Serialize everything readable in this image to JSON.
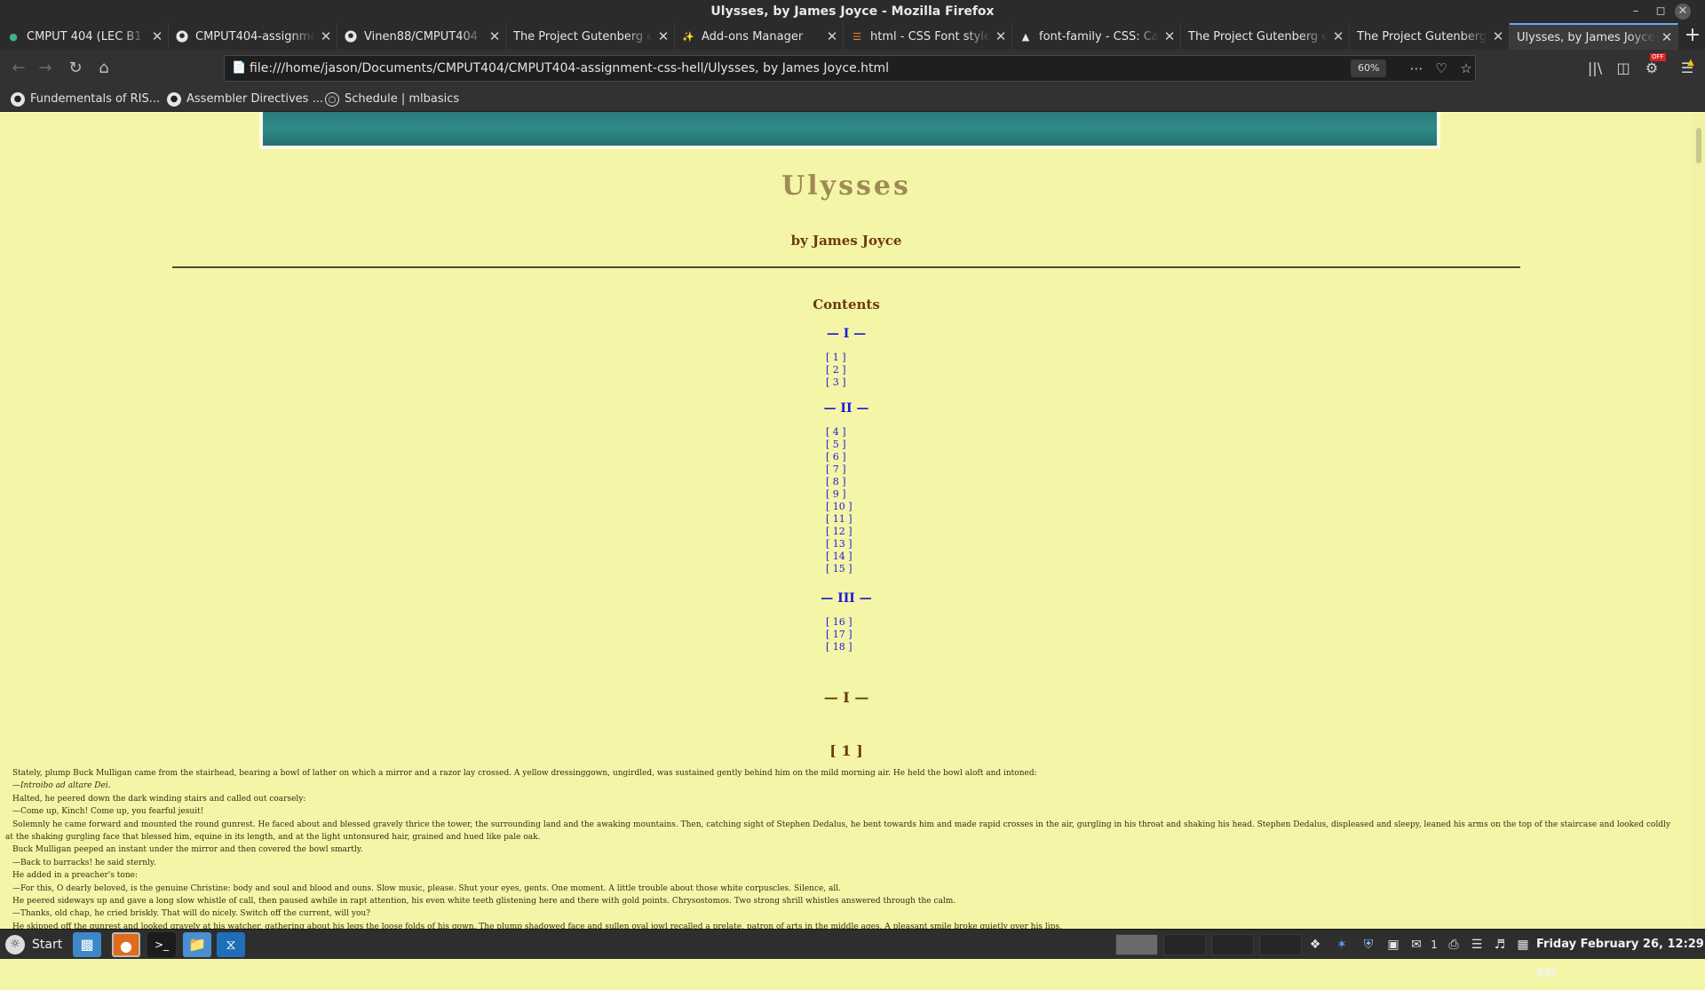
{
  "window": {
    "title": "Ulysses, by James Joyce - Mozilla Firefox"
  },
  "tabs": [
    {
      "label": "CMPUT 404 (LEC B1 W",
      "icon": "eclass-icon"
    },
    {
      "label": "CMPUT404-assignme",
      "icon": "github-icon"
    },
    {
      "label": "Vinen88/CMPUT404",
      "icon": "github-icon"
    },
    {
      "label": "The Project Gutenberg e",
      "icon": "none"
    },
    {
      "label": "Add-ons Manager",
      "icon": "puzzle-icon"
    },
    {
      "label": "html - CSS Font style",
      "icon": "stackoverflow-icon"
    },
    {
      "label": "font-family - CSS: Cas",
      "icon": "mdn-icon"
    },
    {
      "label": "The Project Gutenberg e",
      "icon": "none"
    },
    {
      "label": "The Project Gutenberg e",
      "icon": "none"
    },
    {
      "label": "Ulysses, by James Joyce",
      "icon": "none",
      "active": true
    }
  ],
  "nav": {
    "url": "file:///home/jason/Documents/CMPUT404/CMPUT404-assignment-css-hell/Ulysses, by James Joyce.html",
    "zoom": "60%",
    "badge_off": "OFF"
  },
  "bookmarks": [
    {
      "label": "Fundementals of RIS...",
      "icon": "github-icon"
    },
    {
      "label": "Assembler Directives ...",
      "icon": "github-icon"
    },
    {
      "label": "Schedule | mlbasics",
      "icon": "globe-icon"
    }
  ],
  "page": {
    "title": "Ulysses",
    "author": "by James Joyce",
    "contents_heading": "Contents",
    "toc": [
      {
        "part": "— I —",
        "chapters": [
          "[ 1 ]",
          "[ 2 ]",
          "[ 3 ]"
        ]
      },
      {
        "part": "— II —",
        "chapters": [
          "[ 4 ]",
          "[ 5 ]",
          "[ 6 ]",
          "[ 7 ]",
          "[ 8 ]",
          "[ 9 ]",
          "[ 10 ]",
          "[ 11 ]",
          "[ 12 ]",
          "[ 13 ]",
          "[ 14 ]",
          "[ 15 ]"
        ]
      },
      {
        "part": "— III —",
        "chapters": [
          "[ 16 ]",
          "[ 17 ]",
          "[ 18 ]"
        ]
      }
    ],
    "part_heading": "— I —",
    "chapter_heading": "[ 1 ]",
    "paragraphs": [
      "Stately, plump Buck Mulligan came from the stairhead, bearing a bowl of lather on which a mirror and a razor lay crossed. A yellow dressinggown, ungirdled, was sustained gently behind him on the mild morning air. He held the bowl aloft and intoned:",
      "—Introibo ad altare Dei.",
      "Halted, he peered down the dark winding stairs and called out coarsely:",
      "—Come up, Kinch! Come up, you fearful jesuit!",
      "Solemnly he came forward and mounted the round gunrest. He faced about and blessed gravely thrice the tower, the surrounding land and the awaking mountains. Then, catching sight of Stephen Dedalus, he bent towards him and made rapid crosses in the air, gurgling in his throat and shaking his head. Stephen Dedalus, displeased and sleepy, leaned his arms on the top of the staircase and looked coldly at the shaking gurgling face that blessed him, equine in its length, and at the light untonsured hair, grained and hued like pale oak.",
      "Buck Mulligan peeped an instant under the mirror and then covered the bowl smartly.",
      "—Back to barracks! he said sternly.",
      "He added in a preacher's tone:",
      "—For this, O dearly beloved, is the genuine Christine: body and soul and blood and ouns. Slow music, please. Shut your eyes, gents. One moment. A little trouble about those white corpuscles. Silence, all.",
      "He peered sideways up and gave a long slow whistle of call, then paused awhile in rapt attention, his even white teeth glistening here and there with gold points. Chrysostomos. Two strong shrill whistles answered through the calm.",
      "—Thanks, old chap, he cried briskly. That will do nicely. Switch off the current, will you?",
      "He skipped off the gunrest and looked gravely at his watcher, gathering about his legs the loose folds of his gown. The plump shadowed face and sullen oval jowl recalled a prelate, patron of arts in the middle ages. A pleasant smile broke quietly over his lips."
    ]
  },
  "taskbar": {
    "start_label": "Start",
    "tray_count": "1",
    "clock": "Friday February 26, 12:29 PM"
  }
}
